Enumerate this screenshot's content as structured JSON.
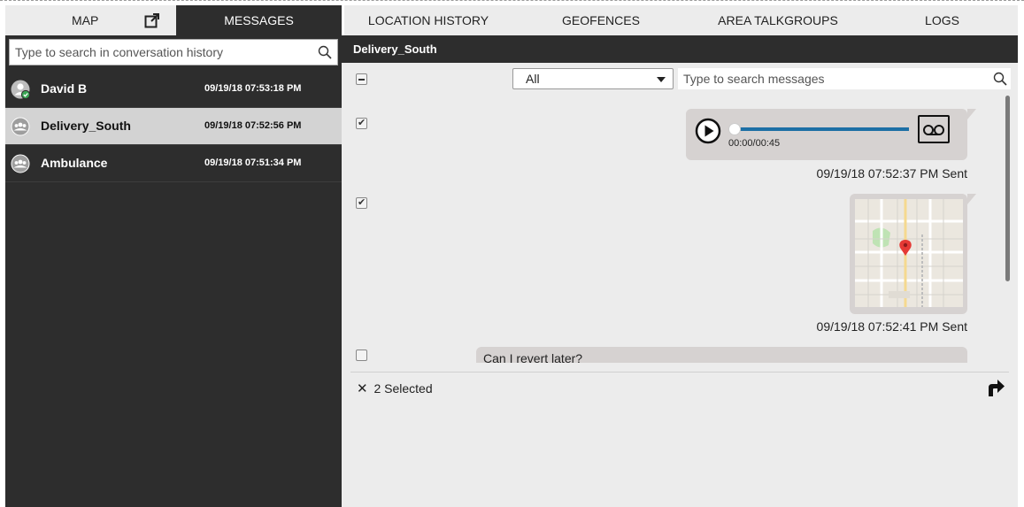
{
  "tabs": {
    "map": "MAP",
    "messages": "MESSAGES",
    "location_history": "LOCATION HISTORY",
    "geofences": "GEOFENCES",
    "area_talkgroups": "AREA TALKGROUPS",
    "logs": "LOGS",
    "active": "MESSAGES"
  },
  "conversation_search": {
    "placeholder": "Type to search in conversation history"
  },
  "conversations": [
    {
      "name": "David B",
      "time": "09/19/18 07:53:18 PM",
      "type": "user",
      "online": true,
      "selected": false
    },
    {
      "name": "Delivery_South",
      "time": "09/19/18 07:52:56 PM",
      "type": "group",
      "selected": true
    },
    {
      "name": "Ambulance",
      "time": "09/19/18 07:51:34 PM",
      "type": "group",
      "selected": false
    }
  ],
  "conversation": {
    "title": "Delivery_South",
    "filter": {
      "selected": "All"
    },
    "message_search": {
      "placeholder": "Type to search messages"
    },
    "messages": [
      {
        "kind": "audio",
        "duration_text": "00:00/00:45",
        "timestamp": "09/19/18 07:52:37 PM Sent",
        "checked": true
      },
      {
        "kind": "location",
        "timestamp": "09/19/18 07:52:41 PM Sent",
        "checked": true
      },
      {
        "kind": "text",
        "text": "Can I revert later?",
        "checked": false
      }
    ],
    "selection": {
      "count_text": "2 Selected"
    }
  },
  "colors": {
    "dark_panel": "#2d2d2d",
    "content_bg": "#ececec",
    "bubble": "#d6d2d1",
    "audio_progress": "#1d6fa5",
    "online_badge": "#3aa655",
    "map_pin": "#e53935"
  },
  "icons": {
    "popout": "external-link-icon",
    "search": "magnifier-icon",
    "play": "play-circle-icon",
    "voicemail": "voicemail-icon",
    "close": "x-icon",
    "forward": "forward-arrow-icon"
  }
}
